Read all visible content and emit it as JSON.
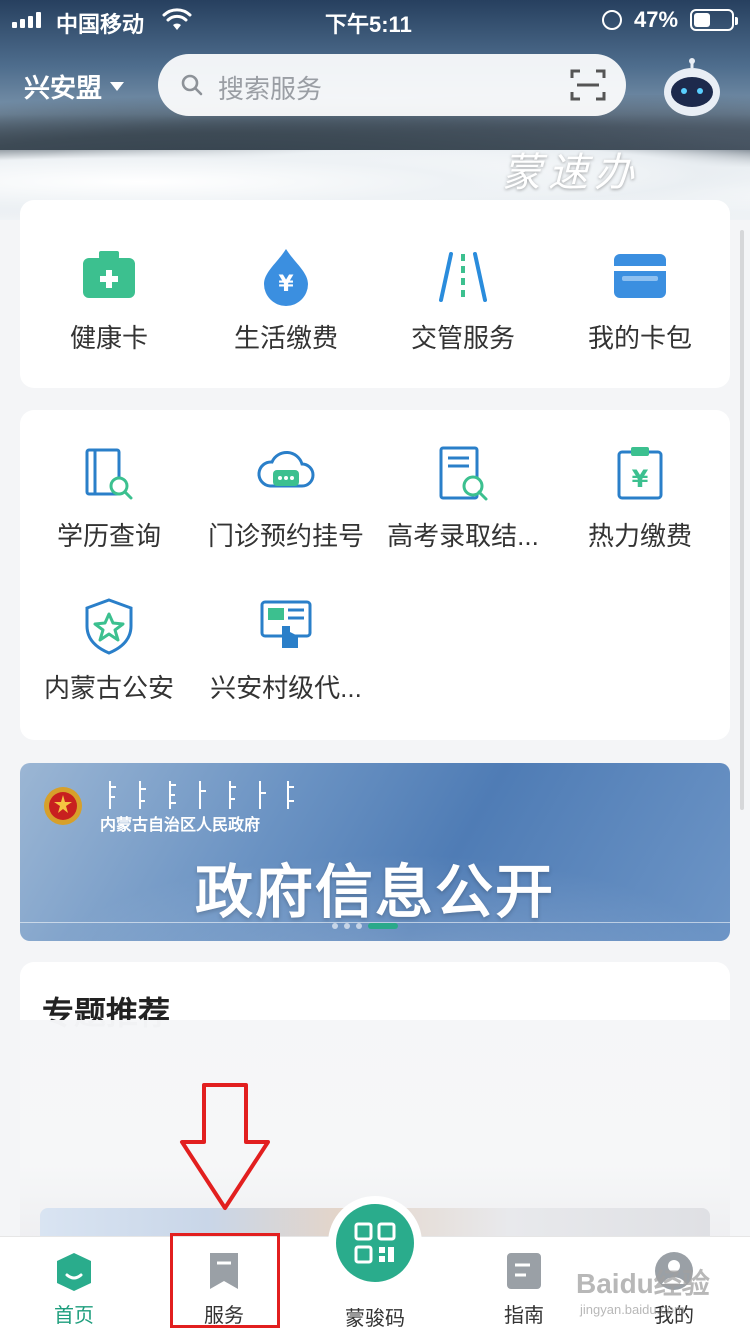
{
  "status_bar": {
    "carrier": "中国移动",
    "time": "下午5:11",
    "battery": "47%"
  },
  "header": {
    "city": "兴安盟",
    "search_placeholder": "搜索服务",
    "slogan": "蒙速办"
  },
  "quick_services": [
    {
      "label": "健康卡",
      "icon": "health-card-icon",
      "color": "#3cc08f"
    },
    {
      "label": "生活缴费",
      "icon": "payment-drop-icon",
      "color": "#3b8fe0"
    },
    {
      "label": "交管服务",
      "icon": "road-icon",
      "color": "#2a8cdc"
    },
    {
      "label": "我的卡包",
      "icon": "wallet-icon",
      "color": "#3b8fe0"
    }
  ],
  "services": [
    {
      "label": "学历查询",
      "icon": "education-search-icon"
    },
    {
      "label": "门诊预约挂号",
      "icon": "chat-cloud-icon"
    },
    {
      "label": "高考录取结...",
      "icon": "exam-result-icon"
    },
    {
      "label": "热力缴费",
      "icon": "heating-bill-icon"
    },
    {
      "label": "内蒙古公安",
      "icon": "police-shield-icon"
    },
    {
      "label": "兴安村级代...",
      "icon": "village-agent-icon"
    }
  ],
  "banner": {
    "government": "内蒙古自治区人民政府",
    "headline": "政府信息公开",
    "slides": 4,
    "active_slide": 4
  },
  "featured": {
    "title": "专题推荐"
  },
  "tab_bar": {
    "tabs": [
      {
        "label": "首页",
        "icon": "home-icon",
        "active": true
      },
      {
        "label": "服务",
        "icon": "service-bookmark-icon",
        "active": false
      },
      {
        "label": "蒙骏码",
        "icon": "qr-code-icon",
        "active": false
      },
      {
        "label": "指南",
        "icon": "guide-icon",
        "active": false
      },
      {
        "label": "我的",
        "icon": "profile-icon",
        "active": false
      }
    ]
  },
  "watermark": {
    "brand": "Baidu经验",
    "url": "jingyan.baidu.com"
  },
  "colors": {
    "accent_green": "#2aac8c",
    "annotation_red": "#e21f1f"
  }
}
